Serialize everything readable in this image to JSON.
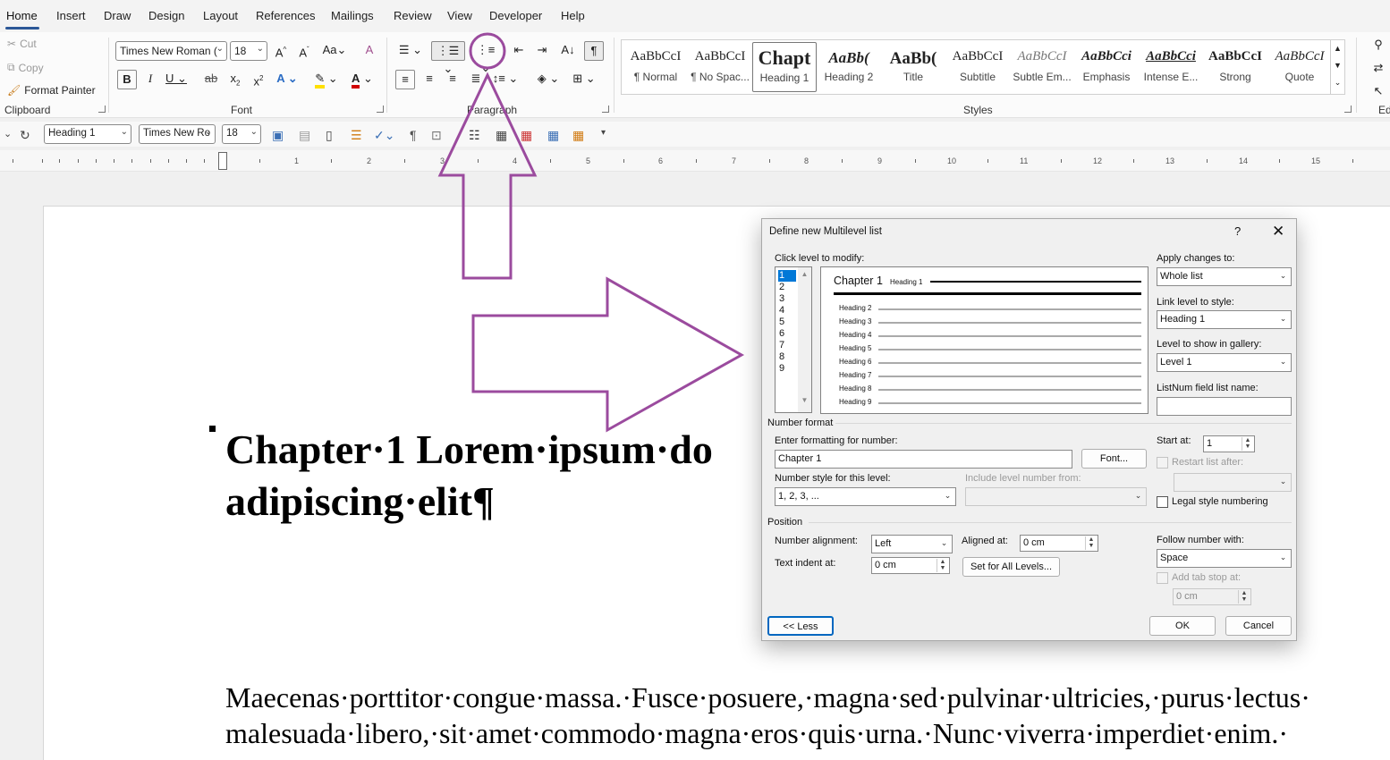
{
  "tabs": [
    "Home",
    "Insert",
    "Draw",
    "Design",
    "Layout",
    "References",
    "Mailings",
    "Review",
    "View",
    "Developer",
    "Help"
  ],
  "clipboard": {
    "cut": "Cut",
    "copy": "Copy",
    "format_painter": "Format Painter",
    "label": "Clipboard"
  },
  "font": {
    "name": "Times New Roman (",
    "size": "18",
    "label": "Font"
  },
  "paragraph": {
    "label": "Paragraph"
  },
  "styles": {
    "label": "Styles",
    "items": [
      {
        "sample": "AaBbCcI",
        "name": "¶ Normal"
      },
      {
        "sample": "AaBbCcI",
        "name": "¶ No Spac..."
      },
      {
        "sample": "Chapt",
        "name": "Heading 1"
      },
      {
        "sample": "AaBb(",
        "name": "Heading 2"
      },
      {
        "sample": "AaBb(",
        "name": "Title"
      },
      {
        "sample": "AaBbCcI",
        "name": "Subtitle"
      },
      {
        "sample": "AaBbCcI",
        "name": "Subtle Em..."
      },
      {
        "sample": "AaBbCci",
        "name": "Emphasis"
      },
      {
        "sample": "AaBbCci",
        "name": "Intense E..."
      },
      {
        "sample": "AaBbCcI",
        "name": "Strong"
      },
      {
        "sample": "AaBbCcI",
        "name": "Quote"
      }
    ]
  },
  "editing_partial": "Ed",
  "qat": {
    "style": "Heading 1",
    "font": "Times New Ro",
    "size": "18"
  },
  "ruler_numbers": [
    "1",
    "1",
    "2",
    "3",
    "4",
    "5",
    "6",
    "7",
    "8",
    "9",
    "10",
    "11",
    "12",
    "13",
    "14",
    "15"
  ],
  "document": {
    "heading_line1": "Chapter·1 Lorem·ipsum·do",
    "heading_line2": "adipiscing·elit¶",
    "body_line1": "Maecenas·porttitor·congue·massa.·Fusce·posuere,·magna·sed·pulvinar·ultricies,·purus·lectus·",
    "body_line2": "malesuada·libero,·sit·amet·commodo·magna·eros·quis·urna.·Nunc·viverra·imperdiet·enim.·"
  },
  "dialog": {
    "title": "Define new Multilevel list",
    "help": "?",
    "close": "✕",
    "click_level": "Click level to modify:",
    "levels": [
      "1",
      "2",
      "3",
      "4",
      "5",
      "6",
      "7",
      "8",
      "9"
    ],
    "preview_chapter": "Chapter 1",
    "preview_h1": "Heading 1",
    "preview_headings": [
      "Heading 2",
      "Heading 3",
      "Heading 4",
      "Heading 5",
      "Heading 6",
      "Heading 7",
      "Heading 8",
      "Heading 9"
    ],
    "apply_changes_label": "Apply changes to:",
    "apply_changes_value": "Whole list",
    "link_level_label": "Link level to style:",
    "link_level_value": "Heading 1",
    "level_gallery_label": "Level to show in gallery:",
    "level_gallery_value": "Level 1",
    "listnum_label": "ListNum field list name:",
    "listnum_value": "",
    "number_format": "Number format",
    "enter_formatting_label": "Enter formatting for number:",
    "enter_formatting_value": "Chapter 1",
    "font_button": "Font...",
    "start_at_label": "Start at:",
    "start_at_value": "1",
    "restart_label": "Restart list after:",
    "number_style_label": "Number style for this level:",
    "number_style_value": "1, 2, 3, ...",
    "include_level_label": "Include level number from:",
    "legal_label": "Legal style numbering",
    "position": "Position",
    "number_alignment_label": "Number alignment:",
    "number_alignment_value": "Left",
    "aligned_at_label": "Aligned at:",
    "aligned_at_value": "0 cm",
    "text_indent_label": "Text indent at:",
    "text_indent_value": "0 cm",
    "set_all_button": "Set for All Levels...",
    "follow_label": "Follow number with:",
    "follow_value": "Space",
    "add_tab_label": "Add tab stop at:",
    "add_tab_value": "0 cm",
    "less_button": "<< Less",
    "ok_button": "OK",
    "cancel_button": "Cancel"
  },
  "colors": {
    "annotation": "#9b4b9e",
    "accent": "#2b5797",
    "selection": "#0078d7"
  }
}
